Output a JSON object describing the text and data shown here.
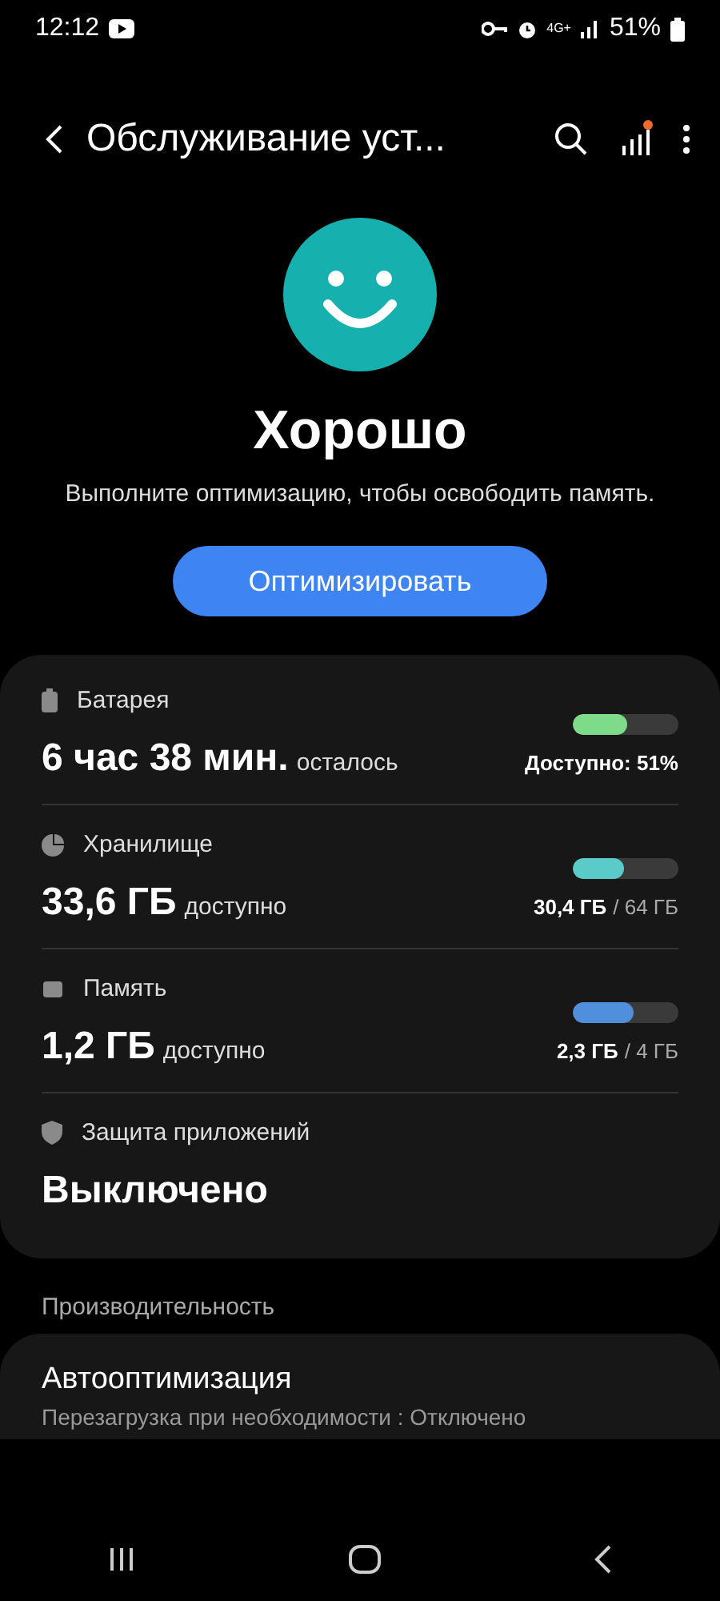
{
  "status_bar": {
    "time": "12:12",
    "network": "4G+",
    "battery": "51%"
  },
  "toolbar": {
    "title": "Обслуживание уст..."
  },
  "status": {
    "title": "Хорошо",
    "message": "Выполните оптимизацию, чтобы освободить память.",
    "button": "Оптимизировать"
  },
  "items": [
    {
      "kind": "battery",
      "label": "Батарея",
      "value": "6 час 38 мин.",
      "suffix": "осталось",
      "level": 0.51,
      "color": "#7ddb8a",
      "reading_main": "Доступно: 51%"
    },
    {
      "kind": "storage",
      "label": "Хранилище",
      "value": "33,6 ГБ",
      "suffix": "доступно",
      "level": 0.48,
      "color": "#5acbc8",
      "reading_main": "30,4 ГБ",
      "reading_rest": "/ 64 ГБ"
    },
    {
      "kind": "memory",
      "label": "Память",
      "value": "1,2 ГБ",
      "suffix": "доступно",
      "level": 0.58,
      "color": "#4f8fdb",
      "reading_main": "2,3 ГБ",
      "reading_rest": "/ 4 ГБ"
    },
    {
      "kind": "protection",
      "label": "Защита приложений",
      "value": "Выключено"
    }
  ],
  "section_label": "Производительность",
  "settings": [
    {
      "title": "Автооптимизация",
      "subtitle": "Перезагрузка при необходимости : Отключено"
    }
  ]
}
